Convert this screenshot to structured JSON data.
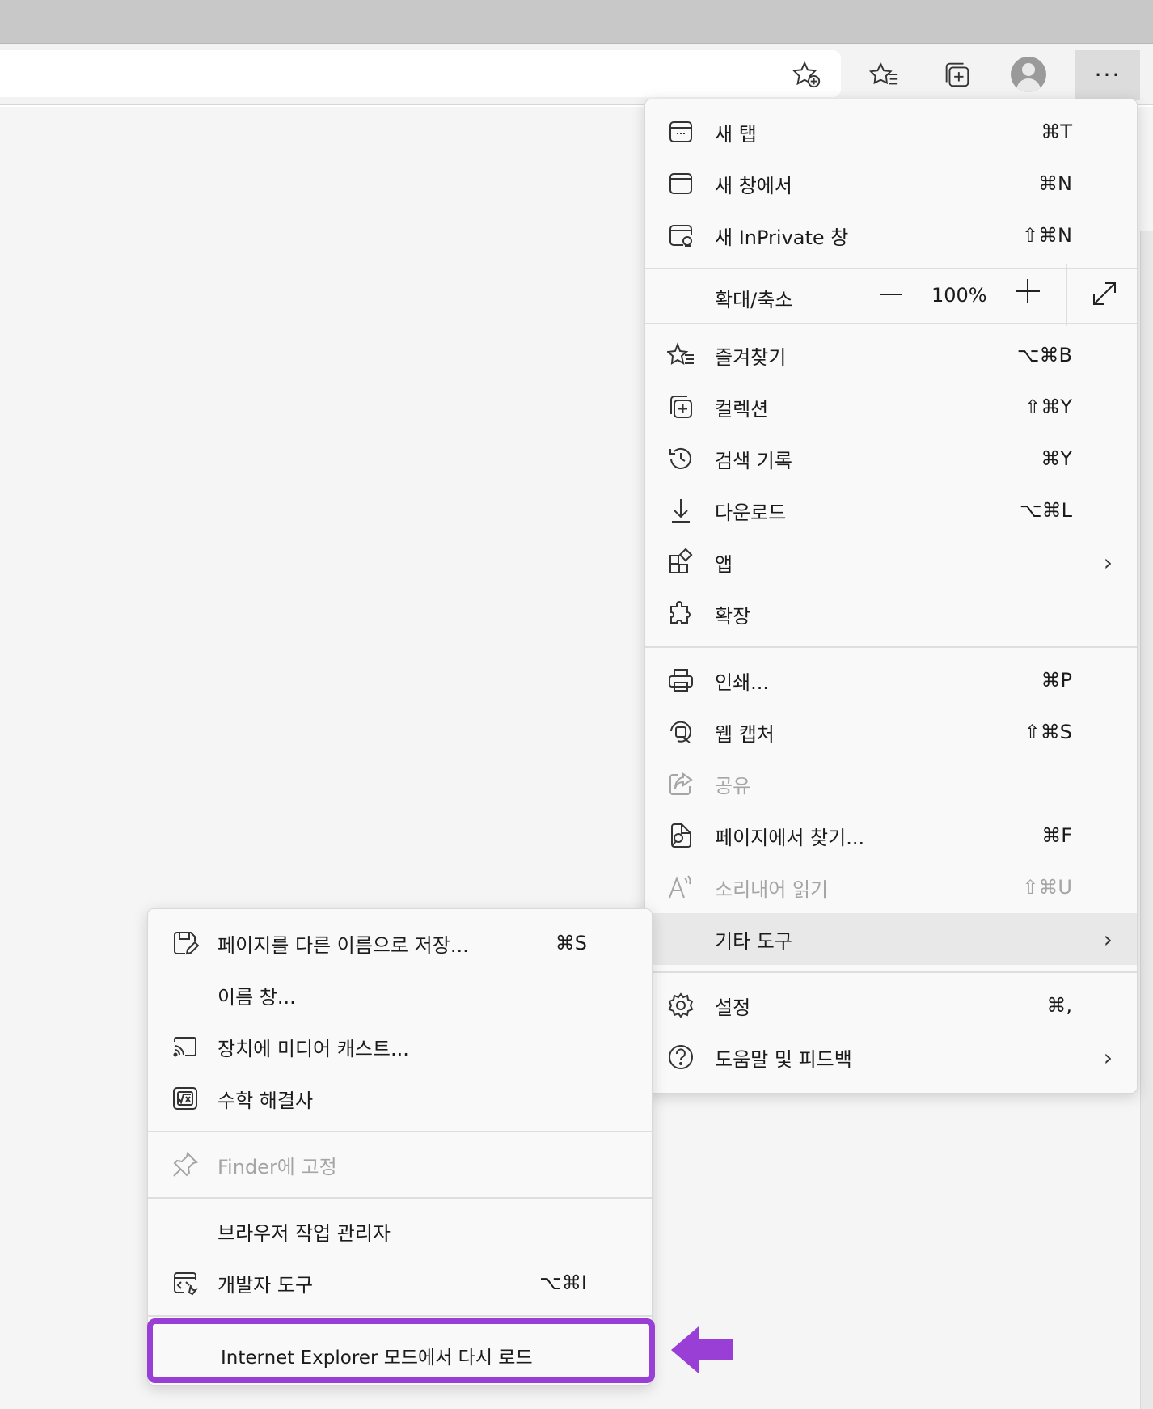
{
  "toolbar": {
    "icons": [
      "add-favorite-icon",
      "favorites-icon",
      "collections-icon",
      "profile-avatar",
      "more-menu-icon"
    ],
    "more_label": "···"
  },
  "menu": {
    "items": [
      {
        "label": "새 탭",
        "shortcut": "⌘T"
      },
      {
        "label": "새 창에서",
        "shortcut": "⌘N"
      },
      {
        "label": "새 InPrivate 창",
        "shortcut": "⇧⌘N"
      },
      {
        "label": "즐겨찾기",
        "shortcut": "⌥⌘B"
      },
      {
        "label": "컬렉션",
        "shortcut": "⇧⌘Y"
      },
      {
        "label": "검색 기록",
        "shortcut": "⌘Y"
      },
      {
        "label": "다운로드",
        "shortcut": "⌥⌘L"
      },
      {
        "label": "앱",
        "shortcut": ""
      },
      {
        "label": "확장",
        "shortcut": ""
      },
      {
        "label": "인쇄...",
        "shortcut": "⌘P"
      },
      {
        "label": "웹 캡처",
        "shortcut": "⇧⌘S"
      },
      {
        "label": "공유",
        "shortcut": ""
      },
      {
        "label": "페이지에서 찾기...",
        "shortcut": "⌘F"
      },
      {
        "label": "소리내어 읽기",
        "shortcut": "⇧⌘U"
      },
      {
        "label": "기타 도구",
        "shortcut": ""
      },
      {
        "label": "설정",
        "shortcut": "⌘,"
      },
      {
        "label": "도움말 및 피드백",
        "shortcut": ""
      }
    ],
    "zoom": {
      "label": "확대/축소",
      "value": "100%"
    }
  },
  "submenu": {
    "items": [
      {
        "label": "페이지를 다른 이름으로 저장...",
        "shortcut": "⌘S"
      },
      {
        "label": "이름 창...",
        "shortcut": ""
      },
      {
        "label": "장치에 미디어 캐스트...",
        "shortcut": ""
      },
      {
        "label": "수학 해결사",
        "shortcut": ""
      },
      {
        "label": "Finder에 고정",
        "shortcut": ""
      },
      {
        "label": "브라우저 작업 관리자",
        "shortcut": ""
      },
      {
        "label": "개발자 도구",
        "shortcut": "⌥⌘I"
      },
      {
        "label": "Internet Explorer 모드에서 다시 로드",
        "shortcut": ""
      }
    ]
  },
  "colors": {
    "highlight_border": "#9a3fd6",
    "menu_bg": "#f9f9f9"
  }
}
